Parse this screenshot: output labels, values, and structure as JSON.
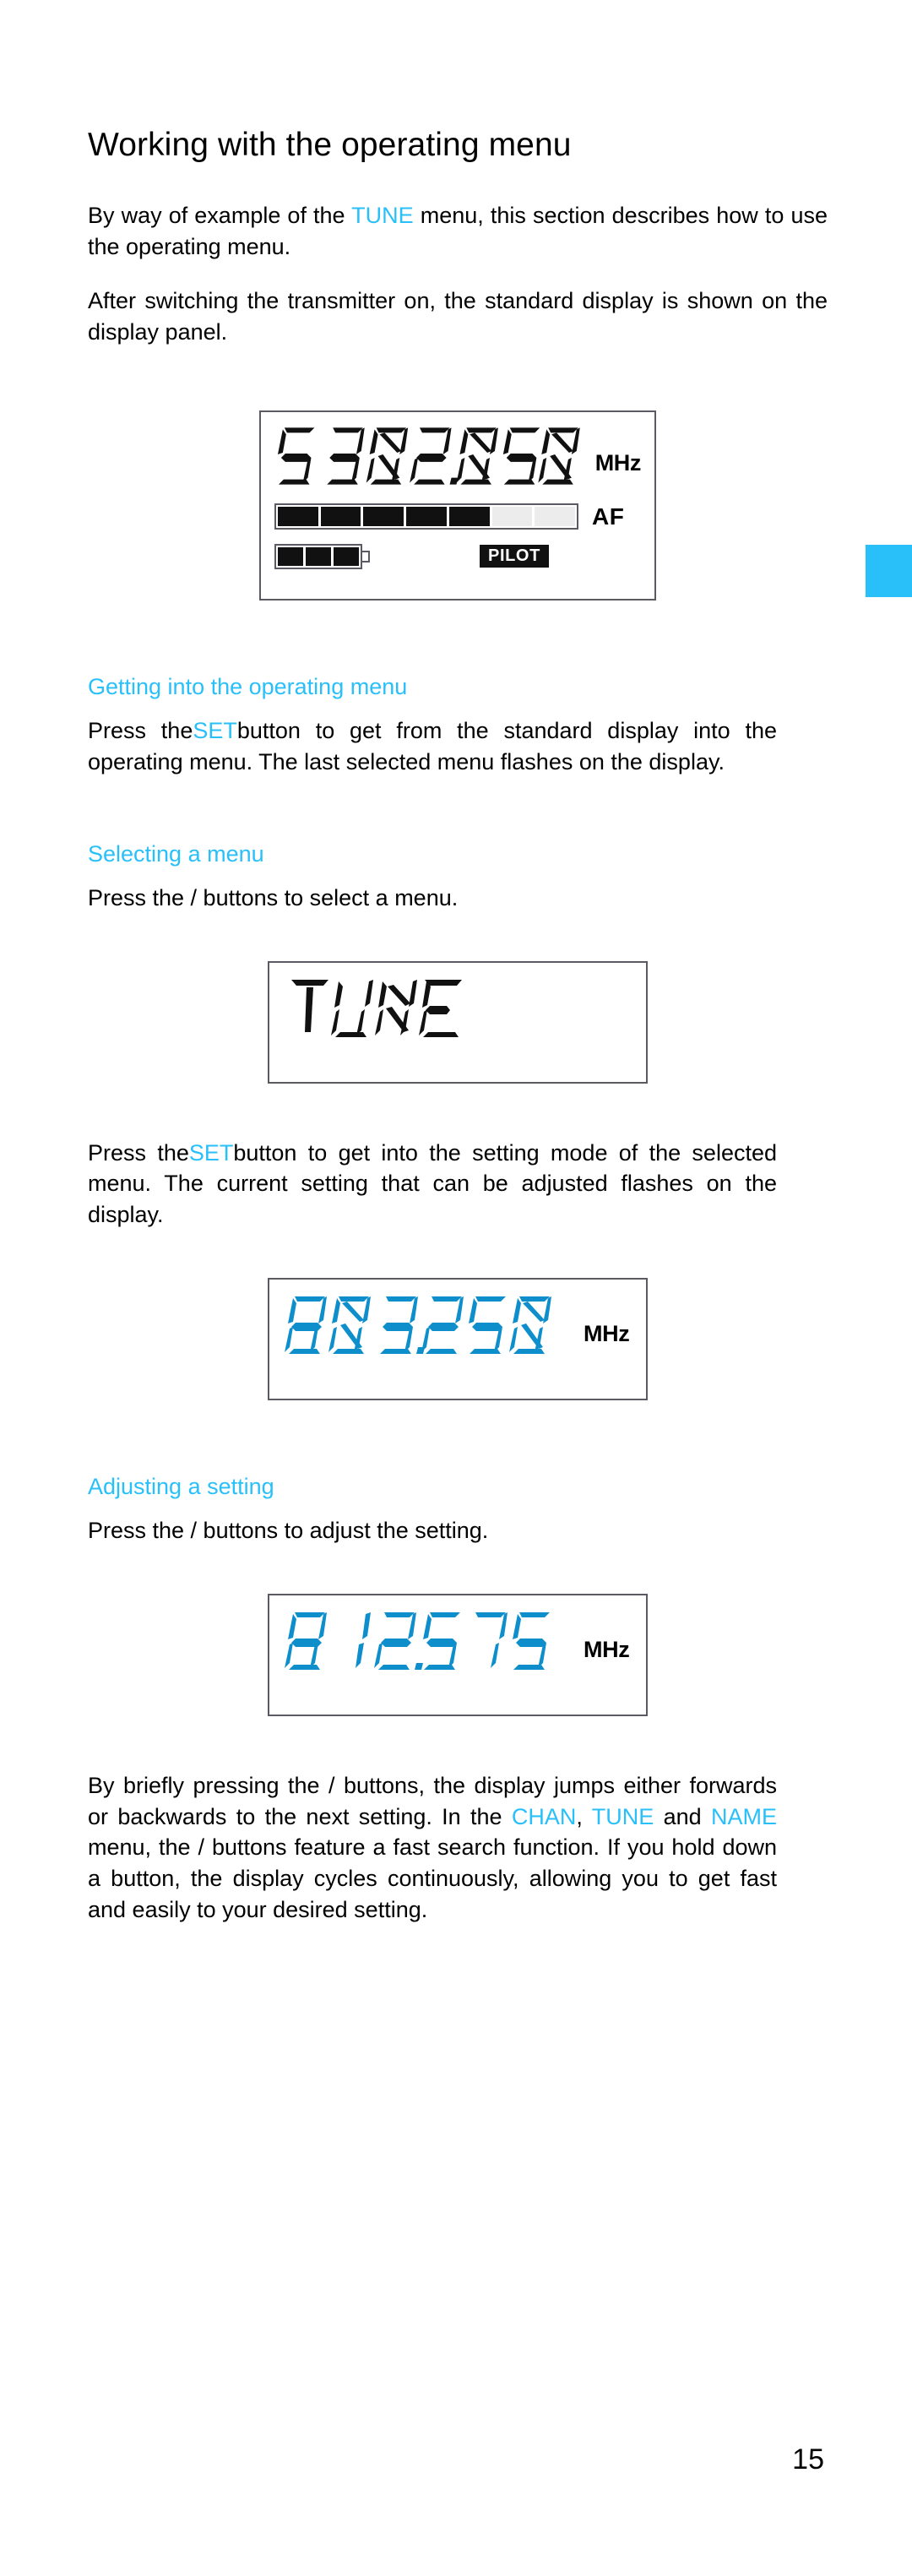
{
  "page": {
    "title": "Working with the operating menu",
    "number": "15",
    "accent_color": "#29C0FA",
    "edge_tab_color": "#29C0FA"
  },
  "intro": {
    "p1_before": "By way of example of the ",
    "p1_accent": "TUNE",
    "p1_after": " menu, this section describes how to use the operating menu.",
    "p2": "After switching the transmitter on, the standard display is shown on the display panel."
  },
  "displays": {
    "standard": {
      "digits": "5 302.050",
      "unit": "MHz",
      "digit_color": "#111111",
      "af_label": "AF",
      "af_segments_total": 8,
      "af_segments_on": 5,
      "battery_cells_total": 4,
      "battery_cells_on": 3,
      "pilot_label": "PILOT"
    },
    "tune_menu": {
      "text": "TUNE",
      "digit_color": "#111111"
    },
    "setting_mode": {
      "digits": "803.250",
      "unit": "MHz",
      "digit_color": "#0E8FCC"
    },
    "adjusted": {
      "digits": "812.575",
      "unit": "MHz",
      "digit_color": "#0E8FCC"
    }
  },
  "sections": [
    {
      "heading": "Getting into the operating menu",
      "body_before": "Press the",
      "body_accent": "SET",
      "body_after": "button to get from the standard display into the operating menu. The last selected menu flashes on the display."
    },
    {
      "heading": "Selecting a menu",
      "body": "Press the  /   buttons to select a menu."
    },
    {
      "heading": "Adjusting a setting",
      "body": "Press the  /   buttons to adjust the setting."
    }
  ],
  "setting_mode_paragraph": {
    "before": "Press the",
    "accent": "SET",
    "after": "button to get into the setting mode of the selected menu. The current setting that can be adjusted flashes on the display."
  },
  "final_paragraph": {
    "line1": "By briefly pressing the  /   buttons, the display jumps either forwards or backwards to the next setting. In the ",
    "accent1": "CHAN",
    "mid1": ", ",
    "accent2": "TUNE",
    "mid2": " and ",
    "accent3": "NAME",
    "after": " menu, the  /   buttons feature a  fast search  function. If you hold down a button, the display cycles continuously, allowing you to get fast and easily to your desired setting."
  }
}
